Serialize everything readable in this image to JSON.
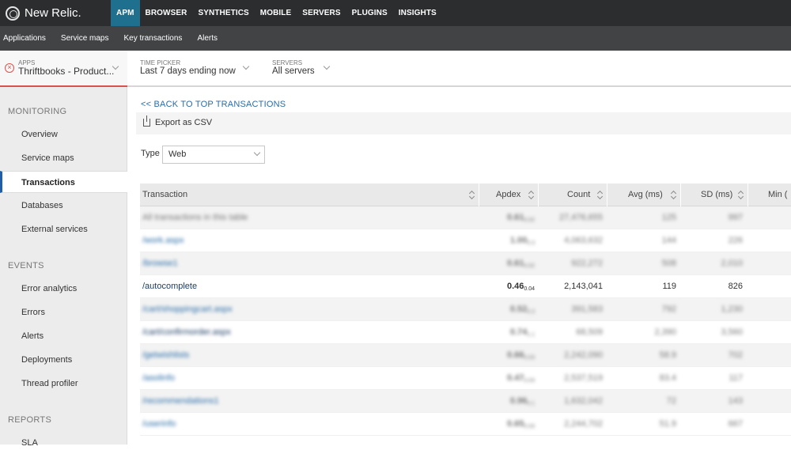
{
  "brand": "New Relic.",
  "topnav": [
    "APM",
    "BROWSER",
    "SYNTHETICS",
    "MOBILE",
    "SERVERS",
    "PLUGINS",
    "INSIGHTS"
  ],
  "subnav": [
    "Applications",
    "Service maps",
    "Key transactions",
    "Alerts"
  ],
  "context": {
    "apps_caption": "APPS",
    "apps_value": "Thriftbooks - Product...",
    "time_caption": "TIME PICKER",
    "time_value": "Last 7 days ending now",
    "servers_caption": "SERVERS",
    "servers_value": "All servers"
  },
  "sidebar": {
    "monitoring": "MONITORING",
    "monitoring_items": [
      "Overview",
      "Service maps",
      "Transactions",
      "Databases",
      "External services"
    ],
    "events": "EVENTS",
    "events_items": [
      "Error analytics",
      "Errors",
      "Alerts",
      "Deployments",
      "Thread profiler"
    ],
    "reports": "REPORTS",
    "reports_items": [
      "SLA"
    ]
  },
  "main": {
    "back_link": "<< BACK TO TOP TRANSACTIONS",
    "export_label": "Export as CSV",
    "type_label": "Type",
    "type_value": "Web"
  },
  "table": {
    "headers": [
      "Transaction",
      "Apdex",
      "Count",
      "Avg (ms)",
      "SD (ms)",
      "Min ("
    ],
    "rows": [
      {
        "name": "All transactions in this table",
        "apdex": "0.61",
        "apdex_t": "0.02",
        "count": "27,476,655",
        "avg": "125",
        "sd": "997",
        "blur": true,
        "style": "blur"
      },
      {
        "name": "/work.aspx",
        "apdex": "1.00",
        "apdex_t": "0.3",
        "count": "4,063,632",
        "avg": "144",
        "sd": "226",
        "blur": true,
        "style": "link"
      },
      {
        "name": "/browse1",
        "apdex": "0.61",
        "apdex_t": "0.02",
        "count": "922,272",
        "avg": "508",
        "sd": "2,010",
        "blur": true,
        "style": "link"
      },
      {
        "name": "/autocomplete",
        "apdex": "0.46",
        "apdex_t": "0.04",
        "count": "2,143,041",
        "avg": "119",
        "sd": "826",
        "blur": false,
        "style": "dark"
      },
      {
        "name": "/cart/shoppingcart.aspx",
        "apdex": "0.52",
        "apdex_t": "0.3",
        "count": "391,583",
        "avg": "792",
        "sd": "1,230",
        "blur": true,
        "style": "link"
      },
      {
        "name": "/cart/confirmorder.aspx",
        "apdex": "0.74",
        "apdex_t": "1.1",
        "count": "68,509",
        "avg": "2,390",
        "sd": "3,560",
        "blur": true,
        "style": "dark"
      },
      {
        "name": "/getwishlists",
        "apdex": "0.66",
        "apdex_t": "0.03",
        "count": "2,242,090",
        "avg": "58.9",
        "sd": "702",
        "blur": true,
        "style": "link"
      },
      {
        "name": "/asolinfo",
        "apdex": "0.47",
        "apdex_t": "0.03",
        "count": "2,537,519",
        "avg": "83.4",
        "sd": "117",
        "blur": true,
        "style": "link"
      },
      {
        "name": "/recommendations1",
        "apdex": "0.96",
        "apdex_t": "0.1",
        "count": "1,632,042",
        "avg": "72",
        "sd": "143",
        "blur": true,
        "style": "link"
      },
      {
        "name": "/userinfo",
        "apdex": "0.65",
        "apdex_t": "0.03",
        "count": "2,244,702",
        "avg": "51.9",
        "sd": "667",
        "blur": true,
        "style": "link"
      }
    ]
  }
}
